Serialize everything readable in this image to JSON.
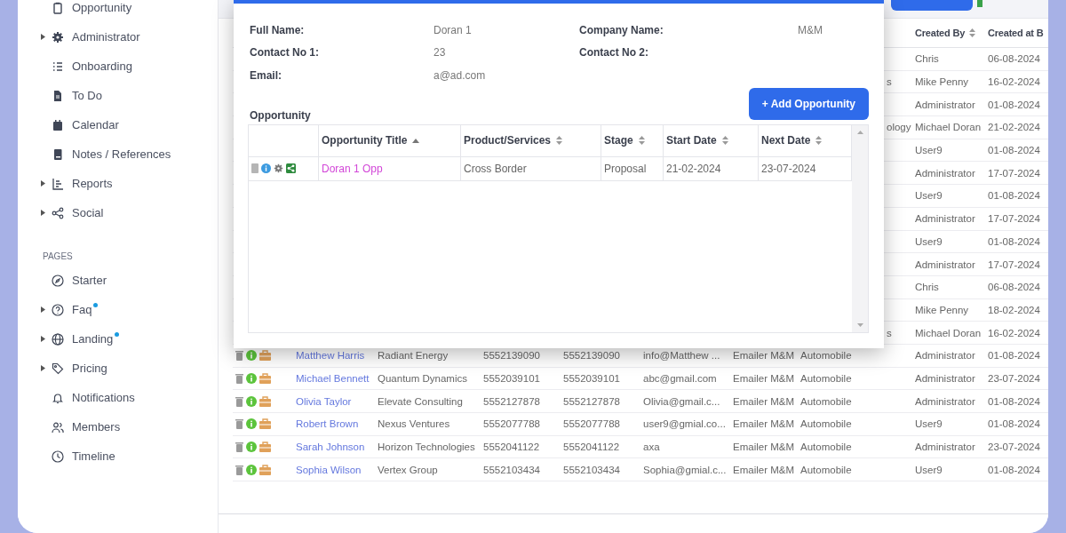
{
  "sidebar": {
    "items": [
      {
        "label": "Opportunity",
        "expandable": false
      },
      {
        "label": "Administrator",
        "expandable": true
      },
      {
        "label": "Onboarding",
        "expandable": false
      },
      {
        "label": "To Do",
        "expandable": false
      },
      {
        "label": "Calendar",
        "expandable": false
      },
      {
        "label": "Notes / References",
        "expandable": false
      },
      {
        "label": "Reports",
        "expandable": true
      },
      {
        "label": "Social",
        "expandable": true
      }
    ],
    "section": "PAGES",
    "pages": [
      {
        "label": "Starter",
        "expandable": false,
        "dot": false
      },
      {
        "label": "Faq",
        "expandable": true,
        "dot": true
      },
      {
        "label": "Landing",
        "expandable": true,
        "dot": true
      },
      {
        "label": "Pricing",
        "expandable": true,
        "dot": false
      },
      {
        "label": "Notifications",
        "expandable": false,
        "dot": false
      },
      {
        "label": "Members",
        "expandable": false,
        "dot": false
      },
      {
        "label": "Timeline",
        "expandable": false,
        "dot": false
      }
    ]
  },
  "table": {
    "columns": [
      {
        "label": "Created By",
        "sortable": true
      },
      {
        "label": "Created at B"
      }
    ],
    "rows": [
      {
        "created_by": "Chris",
        "created_at": "06-08-2024"
      },
      {
        "peek": "s",
        "created_by": "Mike Penny",
        "created_at": "16-02-2024"
      },
      {
        "created_by": "Administrator",
        "created_at": "01-08-2024"
      },
      {
        "peek": "ology",
        "created_by": "Michael Doran",
        "created_at": "21-02-2024"
      },
      {
        "created_by": "User9",
        "created_at": "01-08-2024"
      },
      {
        "created_by": "Administrator",
        "created_at": "17-07-2024"
      },
      {
        "created_by": "User9",
        "created_at": "01-08-2024"
      },
      {
        "created_by": "Administrator",
        "created_at": "17-07-2024"
      },
      {
        "created_by": "User9",
        "created_at": "01-08-2024"
      },
      {
        "created_by": "Administrator",
        "created_at": "17-07-2024"
      },
      {
        "created_by": "Chris",
        "created_at": "06-08-2024"
      },
      {
        "created_by": "Mike Penny",
        "created_at": "18-02-2024"
      },
      {
        "peek": "s",
        "created_by": "Michael Doran",
        "created_at": "16-02-2024"
      },
      {
        "name": "Matthew Harris",
        "company": "Radiant Energy",
        "contact_1": "5552139090",
        "contact_2": "5552139090",
        "email": "info@Matthew ...",
        "source": "Emailer M&M",
        "industry": "Automobile",
        "created_by": "Administrator",
        "created_at": "01-08-2024"
      },
      {
        "name": "Michael Bennett",
        "company": "Quantum Dynamics",
        "contact_1": "5552039101",
        "contact_2": "5552039101",
        "email": "abc@gmail.com",
        "source": "Emailer M&M",
        "industry": "Automobile",
        "created_by": "Administrator",
        "created_at": "23-07-2024"
      },
      {
        "name": "Olivia Taylor",
        "company": "Elevate Consulting",
        "contact_1": "5552127878",
        "contact_2": "5552127878",
        "email": "Olivia@gmail.c...",
        "source": "Emailer M&M",
        "industry": "Automobile",
        "created_by": "Administrator",
        "created_at": "01-08-2024"
      },
      {
        "name": "Robert Brown",
        "company": "Nexus Ventures",
        "contact_1": "5552077788",
        "contact_2": "5552077788",
        "email": "user9@gmial.co...",
        "source": "Emailer M&M",
        "industry": "Automobile",
        "created_by": "User9",
        "created_at": "01-08-2024"
      },
      {
        "name": "Sarah Johnson",
        "company": "Horizon Technologies",
        "contact_1": "5552041122",
        "contact_2": "5552041122",
        "email": "axa",
        "source": "Emailer M&M",
        "industry": "Automobile",
        "created_by": "Administrator",
        "created_at": "23-07-2024"
      },
      {
        "name": "Sophia Wilson",
        "company": "Vertex Group",
        "contact_1": "5552103434",
        "contact_2": "5552103434",
        "email": "Sophia@gmial.c...",
        "source": "Emailer M&M",
        "industry": "Automobile",
        "created_by": "User9",
        "created_at": "01-08-2024"
      }
    ]
  },
  "modal": {
    "fields": [
      {
        "label": "Full Name:",
        "value": "Doran 1"
      },
      {
        "label": "Company Name:",
        "value": "M&M"
      },
      {
        "label": "Contact No 1:",
        "value": "23"
      },
      {
        "label": "Contact No 2:"
      },
      {
        "label": "Email:",
        "value": "a@ad.com"
      }
    ],
    "section": "Opportunity",
    "add_button": "+ Add Opportunity",
    "columns": [
      {
        "label": "Opportunity Title",
        "sorted": true
      },
      {
        "label": "Product/Services",
        "sorted": false
      },
      {
        "label": "Stage",
        "sorted": false
      },
      {
        "label": "Start Date",
        "sorted": false
      },
      {
        "label": "Next Date",
        "sorted": false
      }
    ],
    "rows": [
      {
        "title": "Doran 1 Opp",
        "product": "Cross Border",
        "stage": "Proposal",
        "start": "21-02-2024",
        "next": "23-07-2024"
      }
    ]
  }
}
